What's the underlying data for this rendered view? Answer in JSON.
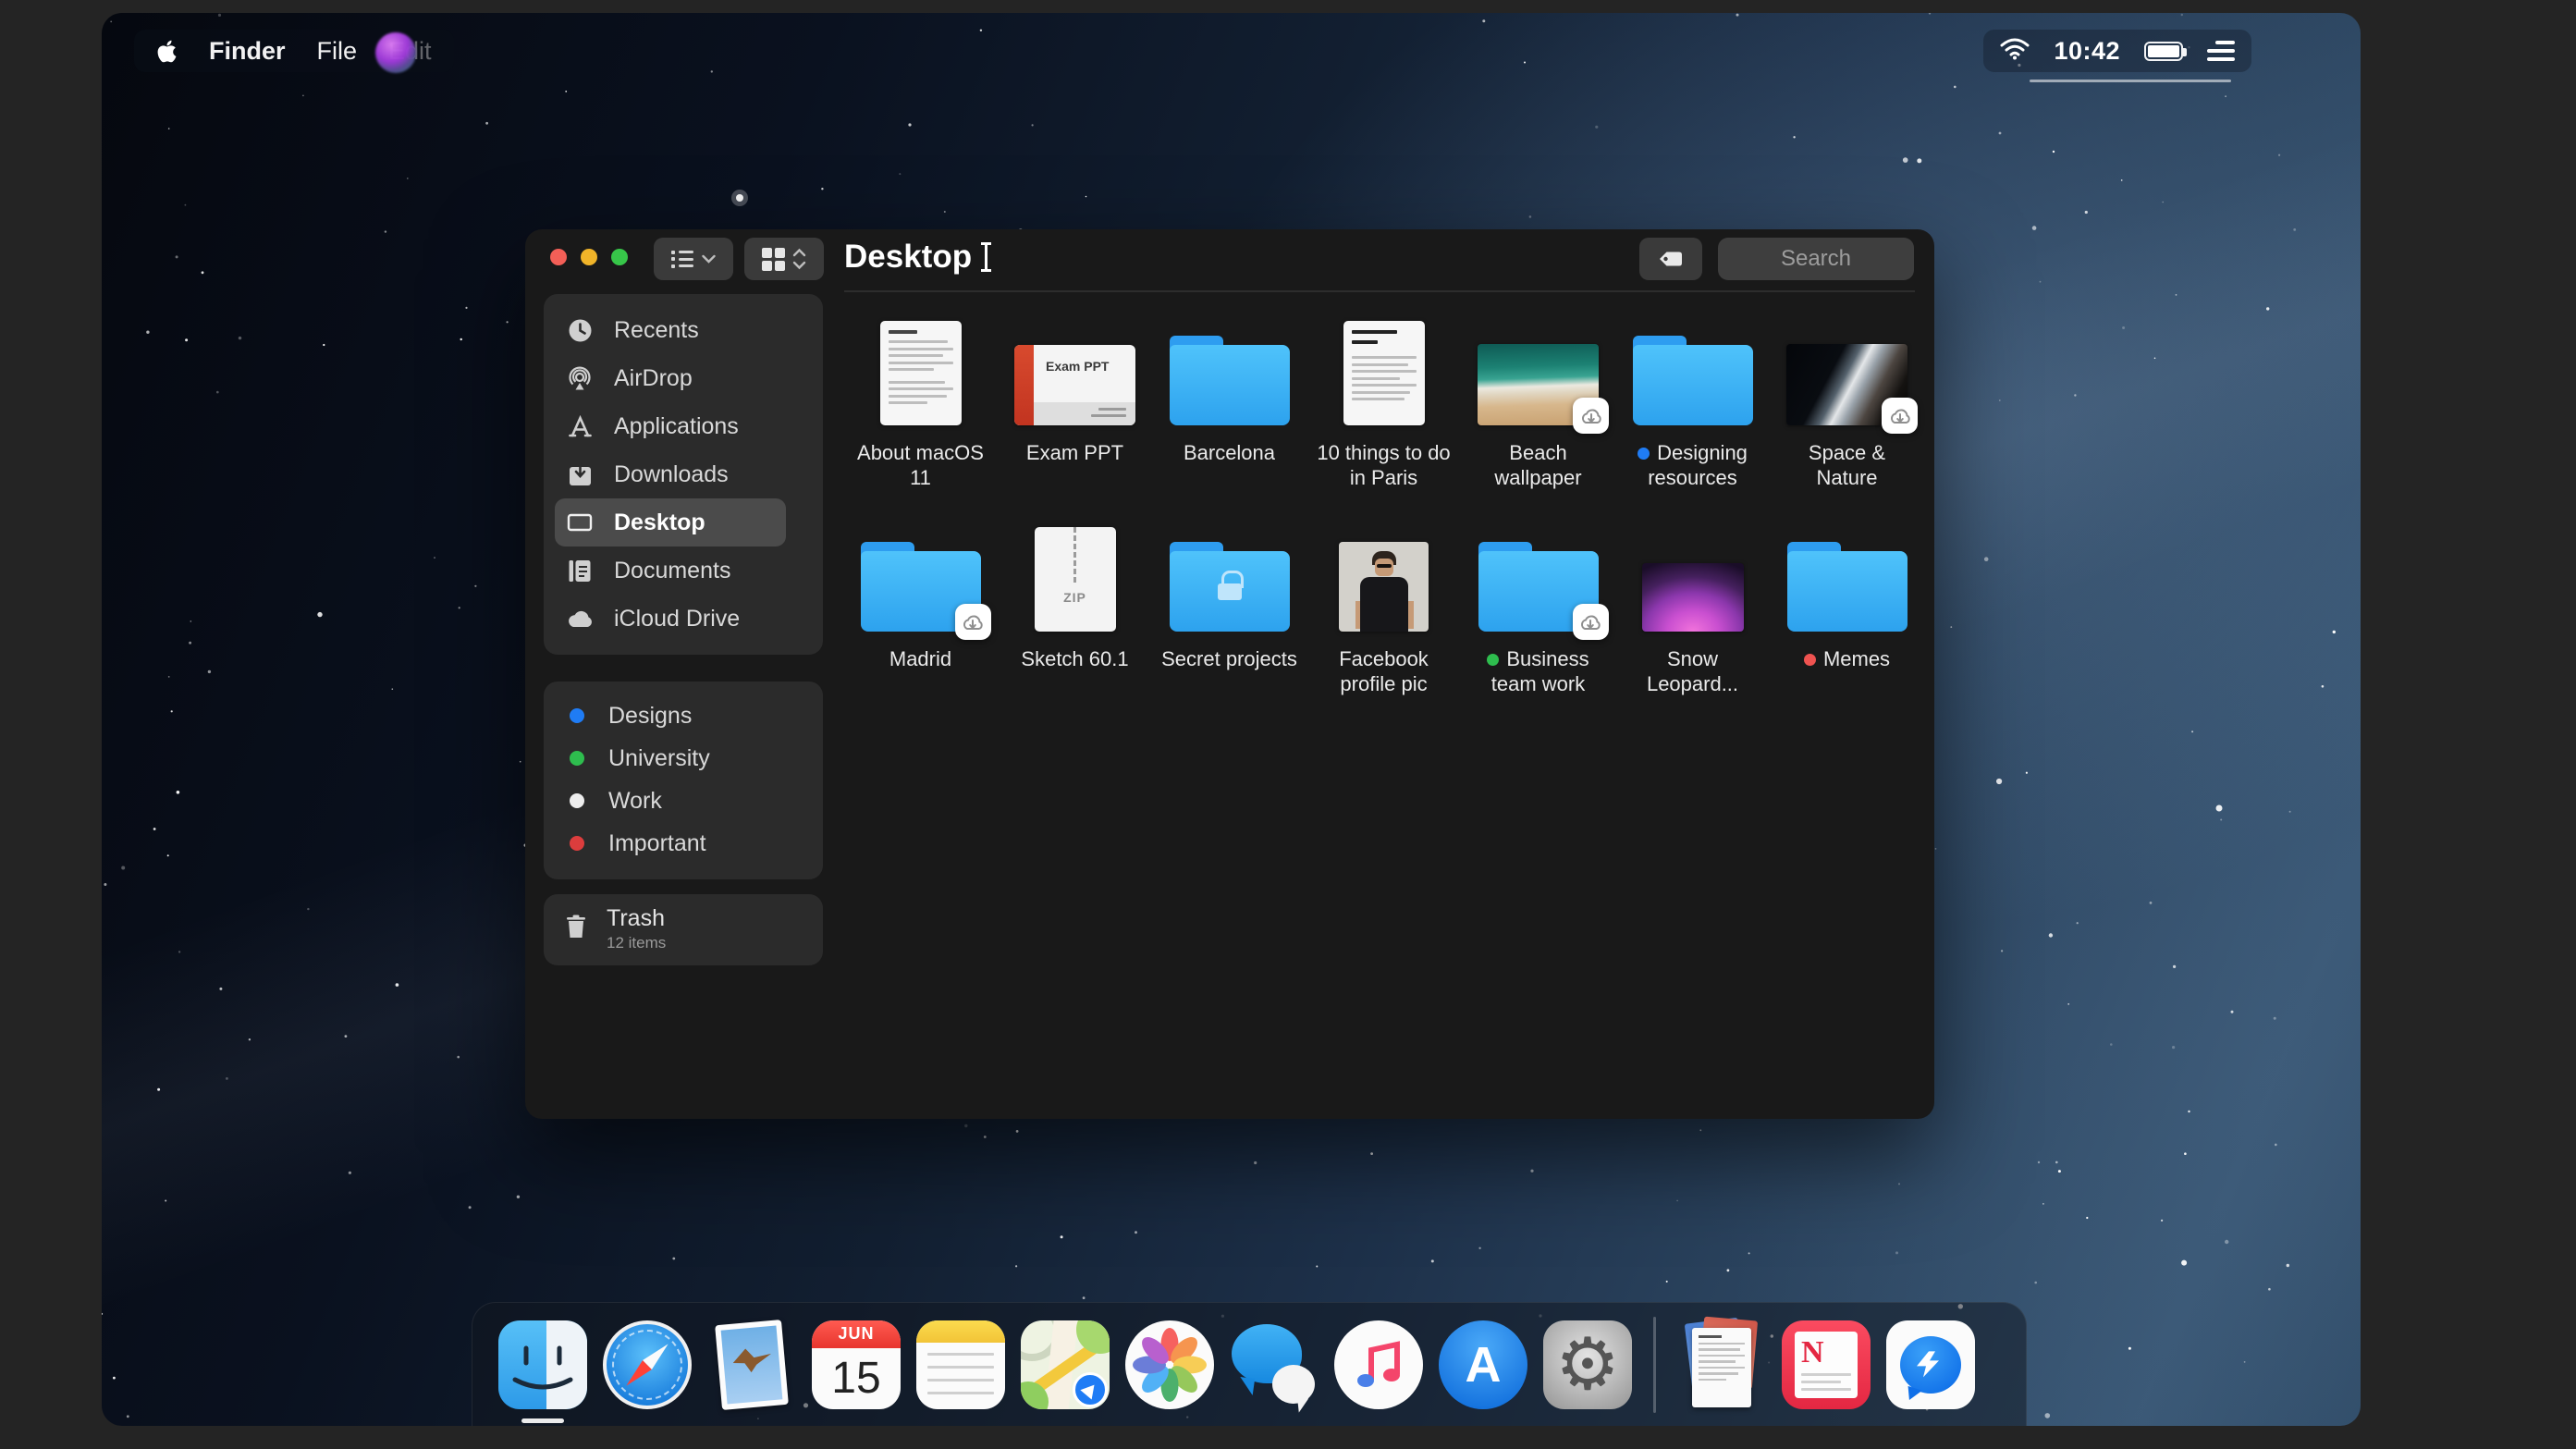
{
  "menu_bar": {
    "menus": [
      "Finder",
      "File",
      "Edit"
    ],
    "time": "10:42"
  },
  "window": {
    "title": "Desktop",
    "search_placeholder": "Search",
    "sidebar": {
      "items": [
        {
          "label": "Recents",
          "icon": "clock"
        },
        {
          "label": "AirDrop",
          "icon": "airdrop"
        },
        {
          "label": "Applications",
          "icon": "applications"
        },
        {
          "label": "Downloads",
          "icon": "download"
        },
        {
          "label": "Desktop",
          "icon": "desktop",
          "selected": true
        },
        {
          "label": "Documents",
          "icon": "document"
        },
        {
          "label": "iCloud Drive",
          "icon": "cloud"
        }
      ],
      "tags": [
        {
          "label": "Designs",
          "color": "#1f7cf5"
        },
        {
          "label": "University",
          "color": "#2ebd4e"
        },
        {
          "label": "Work",
          "color": "#ededed"
        },
        {
          "label": "Important",
          "color": "#dc3d3d"
        }
      ],
      "trash": {
        "label": "Trash",
        "detail": "12 items"
      }
    },
    "files": [
      {
        "name": "About macOS 11",
        "kind": "document"
      },
      {
        "name": "Exam PPT",
        "kind": "presentation",
        "icon_text": "Exam PPT"
      },
      {
        "name": "Barcelona",
        "kind": "folder"
      },
      {
        "name": "10 things to do in Paris",
        "kind": "document"
      },
      {
        "name": "Beach wallpaper",
        "kind": "image",
        "badge": "cloud-download"
      },
      {
        "name": "Designing resources",
        "kind": "folder",
        "tag_color": "#1f7cf5"
      },
      {
        "name": "Space & Nature",
        "kind": "image",
        "badge": "cloud-download"
      },
      {
        "name": "Madrid",
        "kind": "folder",
        "badge": "cloud-download"
      },
      {
        "name": "Sketch 60.1",
        "kind": "zip",
        "icon_text": "ZIP"
      },
      {
        "name": "Secret projects",
        "kind": "folder-locked"
      },
      {
        "name": "Facebook profile pic",
        "kind": "photo"
      },
      {
        "name": "Business team work",
        "kind": "folder",
        "badge": "cloud-download",
        "tag_color": "#2ebd4e"
      },
      {
        "name": "Snow Leopard...",
        "kind": "image"
      },
      {
        "name": "Memes",
        "kind": "folder",
        "tag_color": "#ef5350"
      }
    ],
    "colors": {
      "folder_blue": "#2e9df0",
      "window_bg": "#191919",
      "sidebar_panel": "#2b2b2b"
    }
  },
  "dock": {
    "calendar": {
      "month": "JUN",
      "day": "15"
    },
    "items": [
      "finder",
      "safari",
      "preview",
      "calendar",
      "notes",
      "maps",
      "photos",
      "messages",
      "music",
      "app-store",
      "system-preferences",
      "documents-stack",
      "news",
      "messenger"
    ]
  }
}
